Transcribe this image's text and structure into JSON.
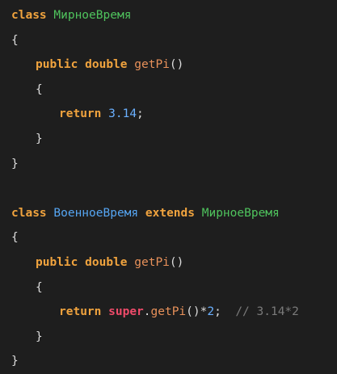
{
  "code": {
    "line1": {
      "kw_class": "class",
      "name": "МирноеВремя"
    },
    "line2": {
      "open": "{"
    },
    "line3": {
      "kw_public": "public",
      "kw_double": "double",
      "method": "getPi",
      "parens": "()"
    },
    "line4": {
      "open": "{"
    },
    "line5": {
      "kw_return": "return",
      "value": "3.14",
      "semi": ";"
    },
    "line6": {
      "close": "}"
    },
    "line7": {
      "close": "}"
    },
    "line9": {
      "kw_class": "class",
      "name": "ВоенноеВремя",
      "kw_extends": "extends",
      "parent": "МирноеВремя"
    },
    "line10": {
      "open": "{"
    },
    "line11": {
      "kw_public": "public",
      "kw_double": "double",
      "method": "getPi",
      "parens": "()"
    },
    "line12": {
      "open": "{"
    },
    "line13": {
      "kw_return": "return",
      "kw_super": "super",
      "dot": ".",
      "method": "getPi",
      "parens": "()",
      "op": "*",
      "value": "2",
      "semi": ";",
      "comment": "// 3.14*2"
    },
    "line14": {
      "close": "}"
    },
    "line15": {
      "close": "}"
    }
  },
  "colors": {
    "background": "#1e1e1e",
    "keyword": "#f0a33e",
    "super_keyword": "#ef4b6a",
    "class_name_green": "#4fc35d",
    "class_name_blue": "#56a6f3",
    "method": "#e8915a",
    "number": "#6ab0ff",
    "comment": "#7a7a7a",
    "text": "#dcdcdc"
  }
}
